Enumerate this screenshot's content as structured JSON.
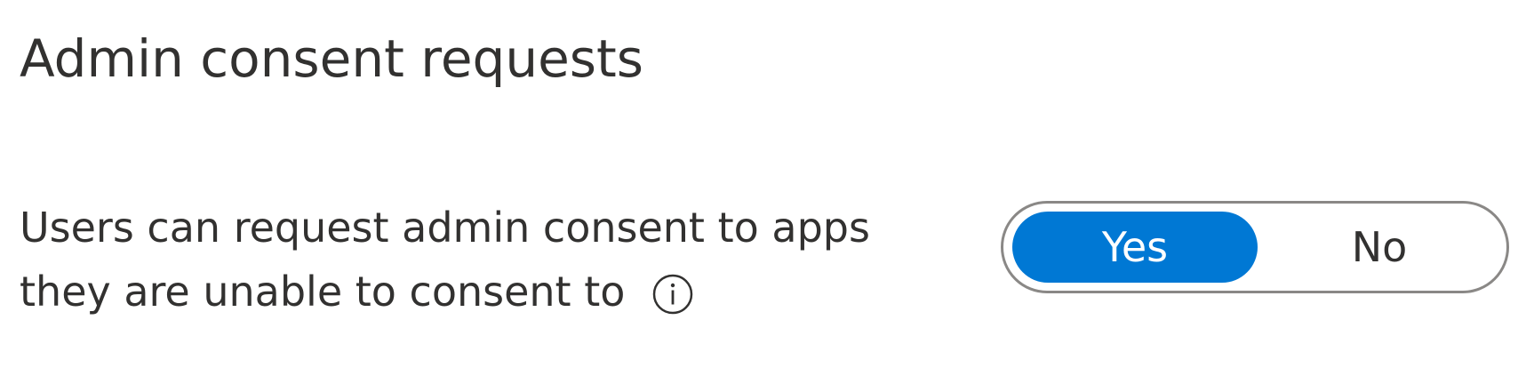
{
  "section": {
    "title": "Admin consent requests"
  },
  "setting": {
    "label_line1": "Users can request admin consent to apps",
    "label_line2": "they are unable to consent to",
    "info_icon": "info-circle-icon"
  },
  "toggle": {
    "options": [
      "Yes",
      "No"
    ],
    "selected": "Yes"
  },
  "colors": {
    "accent": "#0078d4",
    "text": "#323130",
    "toggle_border": "#8a8886"
  }
}
